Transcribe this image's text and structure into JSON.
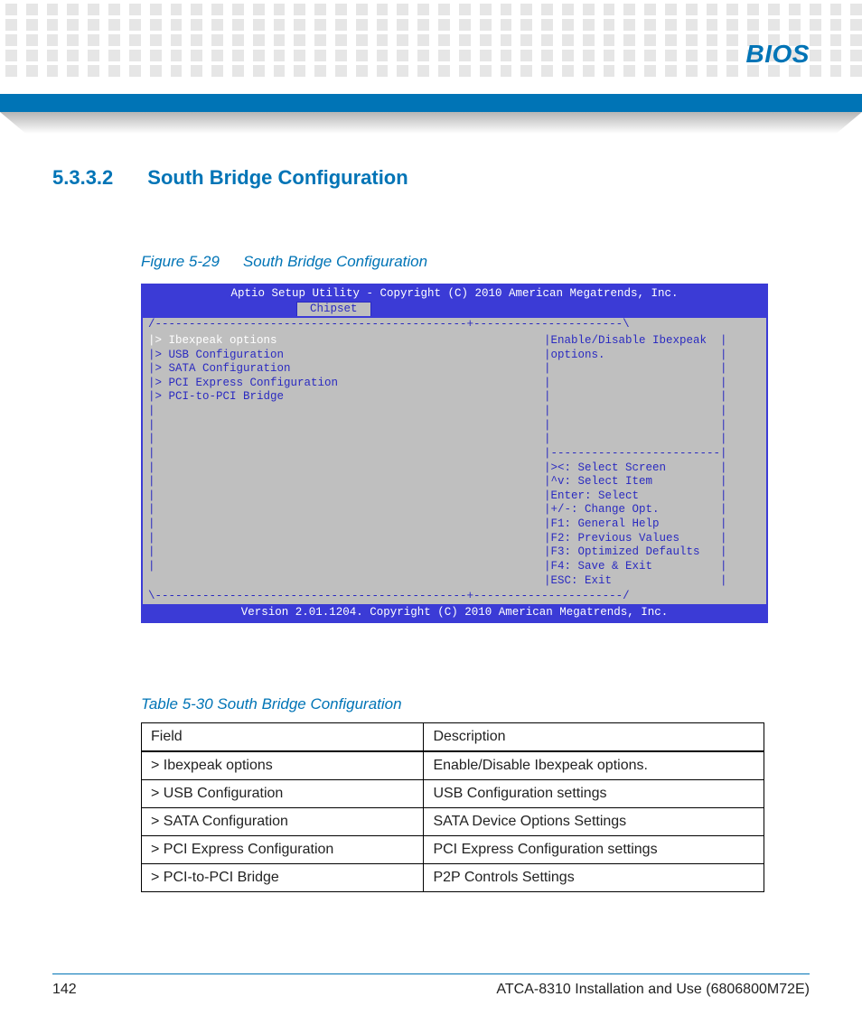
{
  "header": {
    "chapter": "BIOS"
  },
  "section": {
    "number": "5.3.3.2",
    "title": "South Bridge Configuration"
  },
  "figure": {
    "label": "Figure 5-29",
    "title": "South Bridge Configuration"
  },
  "bios": {
    "title": "Aptio Setup Utility - Copyright (C) 2010 American Megatrends, Inc.",
    "tab": "Chipset",
    "top_rule": "/----------------------------------------------+----------------------\\",
    "menu": [
      "|> Ibexpeak options",
      "|> USB Configuration",
      "|> SATA Configuration",
      "|> PCI Express Configuration",
      "|> PCI-to-PCI Bridge",
      "|",
      "|",
      "|",
      "|",
      "|",
      "|",
      "|",
      "|",
      "|",
      "|",
      "|",
      "|"
    ],
    "help_top": [
      "|Enable/Disable Ibexpeak  |",
      "|options.                 |",
      "|                         |",
      "|                         |",
      "|                         |",
      "|                         |",
      "|                         |",
      "|                         |"
    ],
    "help_rule": "|-------------------------|",
    "help_keys": [
      "|><: Select Screen        |",
      "|^v: Select Item          |",
      "|Enter: Select            |",
      "|+/-: Change Opt.         |",
      "|F1: General Help         |",
      "|F2: Previous Values      |",
      "|F3: Optimized Defaults   |",
      "|F4: Save & Exit          |",
      "|ESC: Exit                |"
    ],
    "bottom_rule": "\\----------------------------------------------+----------------------/",
    "footer": "Version 2.01.1204. Copyright (C) 2010 American Megatrends, Inc."
  },
  "table": {
    "caption": "Table 5-30 South Bridge Configuration",
    "head": {
      "c0": "Field",
      "c1": "Description"
    },
    "rows": [
      {
        "c0": "> Ibexpeak options",
        "c1": "Enable/Disable Ibexpeak options."
      },
      {
        "c0": "> USB Configuration",
        "c1": "USB Configuration settings"
      },
      {
        "c0": "> SATA Configuration",
        "c1": "SATA Device Options Settings"
      },
      {
        "c0": "> PCI Express Configuration",
        "c1": "PCI Express Configuration settings"
      },
      {
        "c0": "> PCI-to-PCI Bridge",
        "c1": "P2P Controls Settings"
      }
    ]
  },
  "footer": {
    "page": "142",
    "doc": "ATCA-8310 Installation and Use (6806800M72E)"
  }
}
